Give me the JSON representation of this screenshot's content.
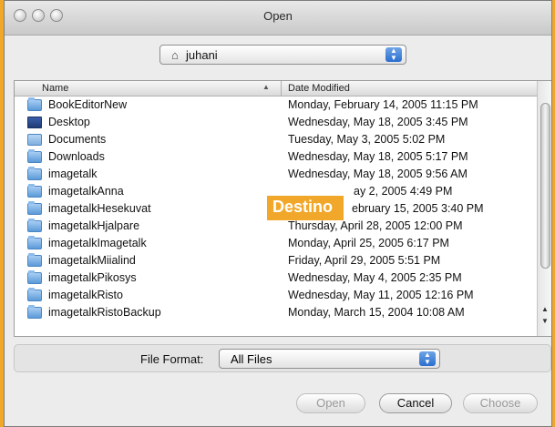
{
  "window": {
    "title": "Open"
  },
  "path_popup": {
    "value": "juhani",
    "icon": "home-icon"
  },
  "columns": {
    "name": "Name",
    "date": "Date Modified"
  },
  "files": [
    {
      "name": "BookEditorNew",
      "date": "Monday, February 14, 2005 11:15 PM",
      "icon": "folder-icon"
    },
    {
      "name": "Desktop",
      "date": "Wednesday, May 18, 2005 3:45 PM",
      "icon": "desktop-folder-icon"
    },
    {
      "name": "Documents",
      "date": "Tuesday, May 3, 2005 5:02 PM",
      "icon": "documents-folder-icon"
    },
    {
      "name": "Downloads",
      "date": "Wednesday, May 18, 2005 5:17 PM",
      "icon": "folder-icon"
    },
    {
      "name": "imagetalk",
      "date": "Wednesday, May 18, 2005 9:56 AM",
      "icon": "folder-icon"
    },
    {
      "name": "imagetalkAnna",
      "date": "ay 2, 2005 4:49 PM",
      "icon": "folder-icon"
    },
    {
      "name": "imagetalkHesekuvat",
      "date": "ebruary 15, 2005 3:40 PM",
      "icon": "folder-icon"
    },
    {
      "name": "imagetalkHjalpare",
      "date": "Thursday, April 28, 2005 12:00 PM",
      "icon": "folder-icon"
    },
    {
      "name": "imagetalkImagetalk",
      "date": "Monday, April 25, 2005 6:17 PM",
      "icon": "folder-icon"
    },
    {
      "name": "imagetalkMiialind",
      "date": "Friday, April 29, 2005 5:51 PM",
      "icon": "folder-icon"
    },
    {
      "name": "imagetalkPikosys",
      "date": "Wednesday, May 4, 2005 2:35 PM",
      "icon": "folder-icon"
    },
    {
      "name": "imagetalkRisto",
      "date": "Wednesday, May 11, 2005 12:16 PM",
      "icon": "folder-icon"
    },
    {
      "name": "imagetalkRistoBackup",
      "date": "Monday, March 15, 2004 10:08 AM",
      "icon": "folder-icon"
    }
  ],
  "overlay": {
    "label": "Destino"
  },
  "file_format": {
    "label": "File Format:",
    "value": "All Files"
  },
  "buttons": {
    "open": "Open",
    "cancel": "Cancel",
    "choose": "Choose"
  },
  "colors": {
    "accent_orange": "#f1a72a",
    "aqua_blue": "#2a6ecf"
  }
}
